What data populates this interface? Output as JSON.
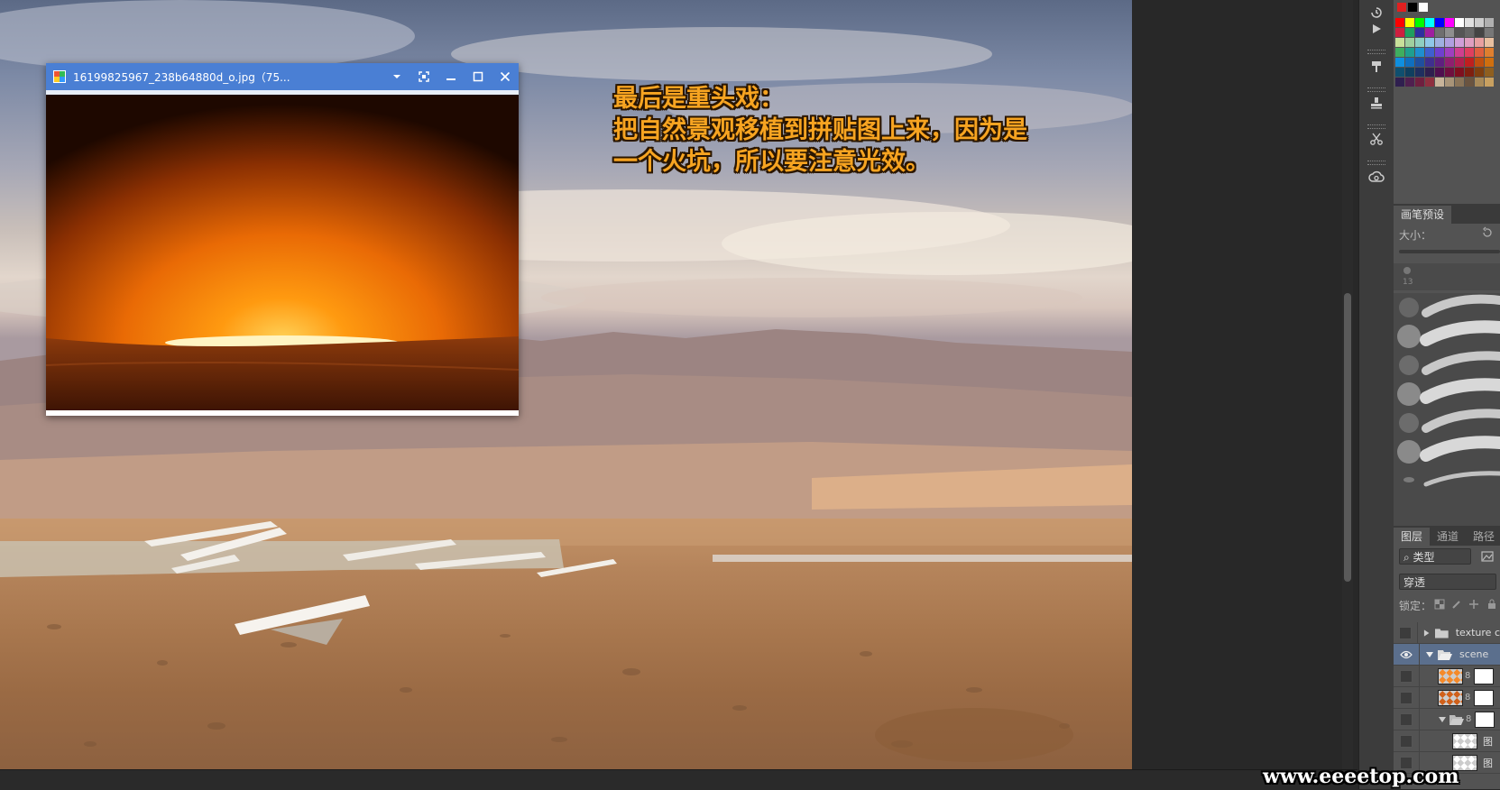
{
  "canvas": {
    "annotation_lines": [
      "最后是重头戏：",
      "把自然景观移植到拼贴图上来，因为是",
      "一个火坑，所以要注意光效。"
    ]
  },
  "image_window": {
    "title": "16199825967_238b64880d_o.jpg（75...",
    "title_bar_color": "#4a7fd4",
    "buttons": [
      "chevron-down-icon",
      "fit-screen-icon",
      "minimize-icon",
      "maximize-icon",
      "close-icon"
    ]
  },
  "brush_panel": {
    "tab_label": "画笔预设",
    "size_label": "大小：",
    "brush_size_number": "13"
  },
  "layers_panel": {
    "tabs": [
      "图层",
      "通道",
      "路径"
    ],
    "filter_kind": "类型",
    "blend_mode": "穿透",
    "lock_label": "锁定：",
    "layers": [
      {
        "name": "texture c",
        "type": "group",
        "expanded": false,
        "visible": false,
        "active": false
      },
      {
        "name": "scene",
        "type": "group",
        "expanded": true,
        "visible": true,
        "active": true
      },
      {
        "name": "",
        "type": "layer",
        "visible": false
      },
      {
        "name": "",
        "type": "layer",
        "visible": false
      },
      {
        "name": "",
        "type": "group",
        "expanded": true,
        "visible": false
      },
      {
        "name": "图",
        "type": "layer",
        "visible": false
      },
      {
        "name": "图",
        "type": "layer",
        "visible": false
      }
    ]
  },
  "watermark": "www.eeeetop.com",
  "colors": {
    "annotation_text": "#f7a421",
    "active_layer": "#5b6f8d",
    "panel_bg": "#535353"
  }
}
